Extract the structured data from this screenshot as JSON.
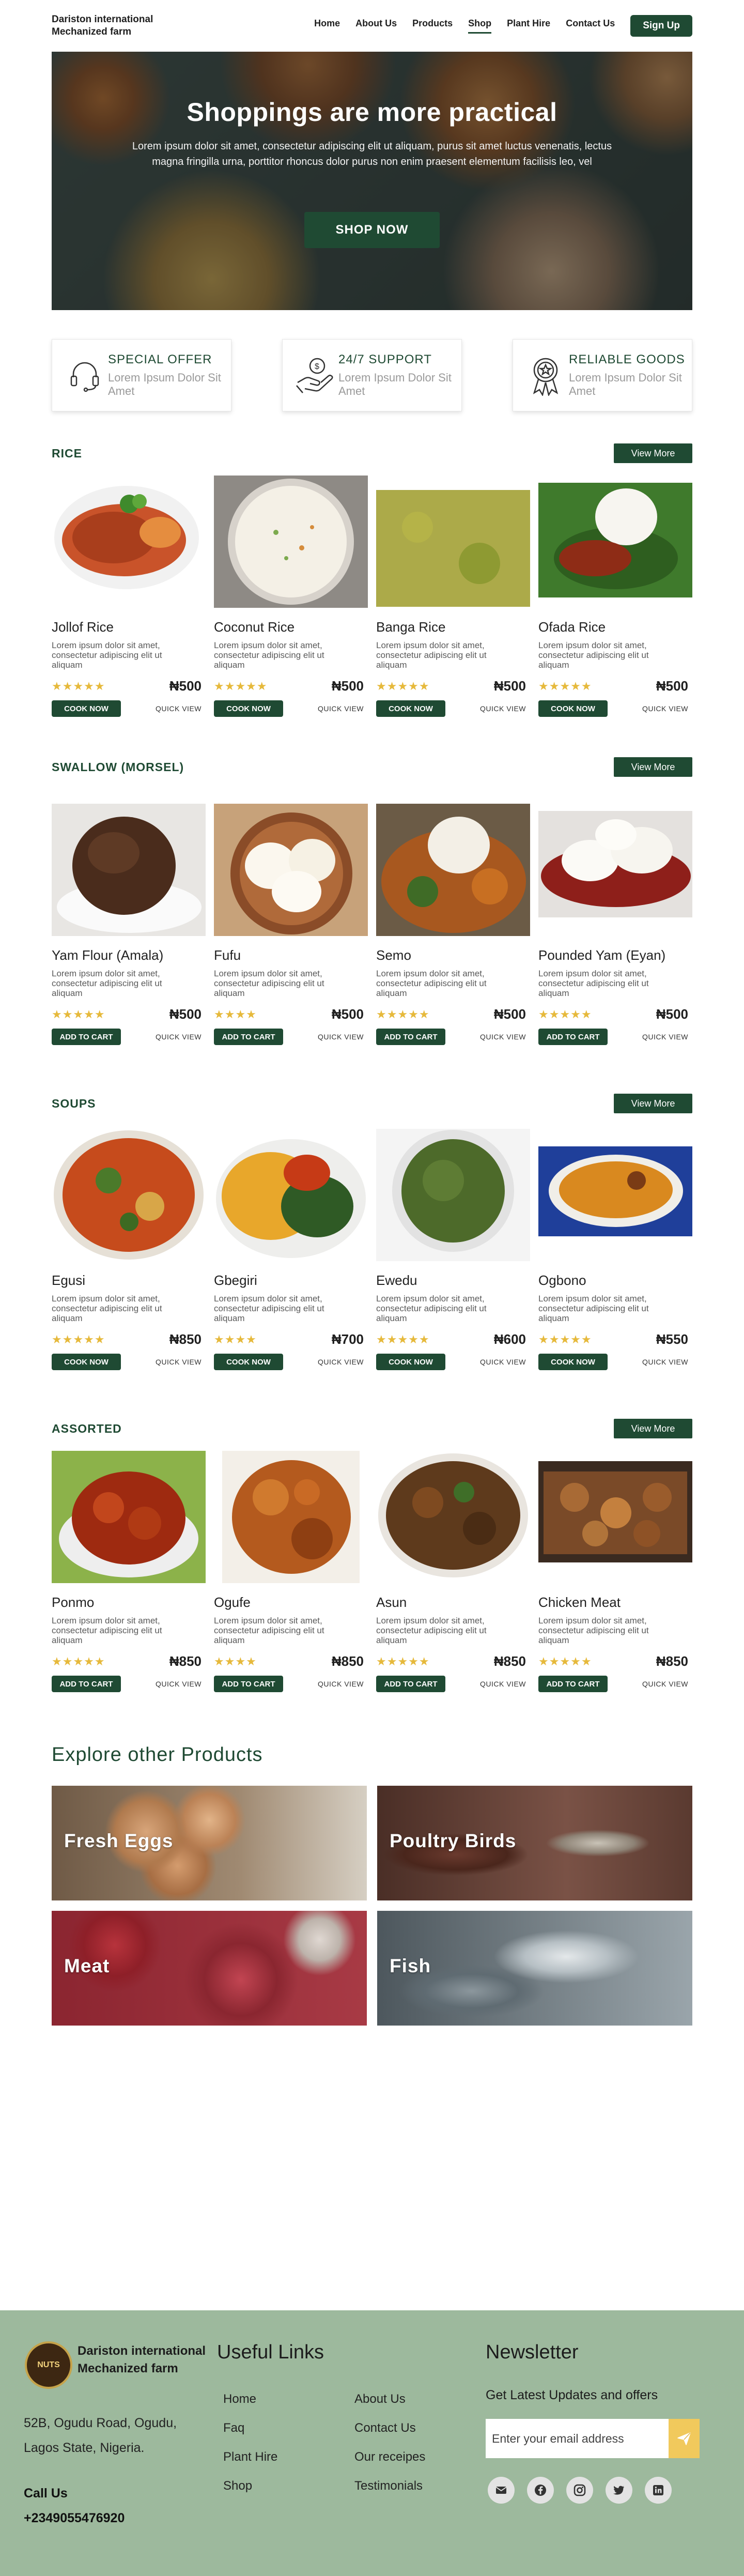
{
  "nav": {
    "brand": "Dariston international Mechanized farm",
    "links": [
      {
        "label": "Home",
        "active": false
      },
      {
        "label": "About Us",
        "active": false
      },
      {
        "label": "Products",
        "active": false
      },
      {
        "label": "Shop",
        "active": true
      },
      {
        "label": "Plant Hire",
        "active": false
      },
      {
        "label": "Contact Us",
        "active": false
      }
    ],
    "signup_label": "Sign Up"
  },
  "hero": {
    "title": "Shoppings are more practical",
    "text": "Lorem ipsum dolor sit amet, consectetur adipiscing elit ut aliquam, purus sit amet luctus venenatis, lectus magna fringilla urna, porttitor rhoncus dolor purus non enim praesent elementum facilisis leo, vel",
    "button": "SHOP NOW"
  },
  "features": [
    {
      "icon": "headset-icon",
      "title": "SPECIAL OFFER",
      "subtitle": "Lorem Ipsum Dolor Sit Amet"
    },
    {
      "icon": "hand-coin-icon",
      "title": "24/7 SUPPORT",
      "subtitle": "Lorem Ipsum Dolor Sit Amet"
    },
    {
      "icon": "award-badge-icon",
      "title": "RELIABLE GOODS",
      "subtitle": "Lorem Ipsum Dolor Sit Amet"
    }
  ],
  "sections": [
    {
      "title": "RICE",
      "view_more": "View More",
      "items": [
        {
          "name": "Jollof Rice",
          "desc": "Lorem ipsum dolor sit amet, consectetur adipiscing elit ut aliquam",
          "stars": "★★★★★",
          "price": "₦500",
          "button": "COOK NOW",
          "quick": "QUICK VIEW",
          "image": "jollof-rice-image"
        },
        {
          "name": "Coconut Rice",
          "desc": "Lorem ipsum dolor sit amet, consectetur adipiscing elit ut aliquam",
          "stars": "★★★★★",
          "price": "₦500",
          "button": "COOK NOW",
          "quick": "QUICK VIEW",
          "image": "coconut-rice-image"
        },
        {
          "name": "Banga Rice",
          "desc": "Lorem ipsum dolor sit amet, consectetur adipiscing elit ut aliquam",
          "stars": "★★★★★",
          "price": "₦500",
          "button": "COOK NOW",
          "quick": "QUICK VIEW",
          "image": "banga-rice-image"
        },
        {
          "name": "Ofada Rice",
          "desc": "Lorem ipsum dolor sit amet, consectetur adipiscing elit ut aliquam",
          "stars": "★★★★★",
          "price": "₦500",
          "button": "COOK NOW",
          "quick": "QUICK VIEW",
          "image": "ofada-rice-image"
        }
      ]
    },
    {
      "title": "SWALLOW (MORSEL)",
      "view_more": "View More",
      "items": [
        {
          "name": "Yam Flour (Amala)",
          "desc": "Lorem ipsum dolor sit amet, consectetur adipiscing elit ut aliquam",
          "stars": "★★★★★",
          "price": "₦500",
          "button": "ADD TO CART",
          "quick": "QUICK VIEW",
          "image": "amala-image"
        },
        {
          "name": "Fufu",
          "desc": "Lorem ipsum dolor sit amet, consectetur adipiscing elit ut aliquam",
          "stars": "★★★★",
          "price": "₦500",
          "button": "ADD TO CART",
          "quick": "QUICK VIEW",
          "image": "fufu-image"
        },
        {
          "name": "Semo",
          "desc": "Lorem ipsum dolor sit amet, consectetur adipiscing elit ut aliquam",
          "stars": "★★★★★",
          "price": "₦500",
          "button": "ADD TO CART",
          "quick": "QUICK VIEW",
          "image": "semo-image"
        },
        {
          "name": "Pounded Yam (Eyan)",
          "desc": "Lorem ipsum dolor sit amet, consectetur adipiscing elit ut aliquam",
          "stars": "★★★★★",
          "price": "₦500",
          "button": "ADD TO CART",
          "quick": "QUICK VIEW",
          "image": "pounded-yam-image"
        }
      ]
    },
    {
      "title": "SOUPS",
      "view_more": "View More",
      "items": [
        {
          "name": "Egusi",
          "desc": "Lorem ipsum dolor sit amet, consectetur adipiscing elit ut aliquam",
          "stars": "★★★★★",
          "price": "₦850",
          "button": "COOK NOW",
          "quick": "QUICK VIEW",
          "image": "egusi-image"
        },
        {
          "name": "Gbegiri",
          "desc": "Lorem ipsum dolor sit amet, consectetur adipiscing elit ut aliquam",
          "stars": "★★★★",
          "price": "₦700",
          "button": "COOK NOW",
          "quick": "QUICK VIEW",
          "image": "gbegiri-image"
        },
        {
          "name": "Ewedu",
          "desc": "Lorem ipsum dolor sit amet, consectetur adipiscing elit ut aliquam",
          "stars": "★★★★★",
          "price": "₦600",
          "button": "COOK NOW",
          "quick": "QUICK VIEW",
          "image": "ewedu-image"
        },
        {
          "name": "Ogbono",
          "desc": "Lorem ipsum dolor sit amet, consectetur adipiscing elit ut aliquam",
          "stars": "★★★★★",
          "price": "₦550",
          "button": "COOK NOW",
          "quick": "QUICK VIEW",
          "image": "ogbono-image"
        }
      ]
    },
    {
      "title": "ASSORTED",
      "view_more": "View More",
      "items": [
        {
          "name": "Ponmo",
          "desc": "Lorem ipsum dolor sit amet, consectetur adipiscing elit ut aliquam",
          "stars": "★★★★★",
          "price": "₦850",
          "button": "ADD TO CART",
          "quick": "QUICK VIEW",
          "image": "ponmo-image"
        },
        {
          "name": "Ogufe",
          "desc": "Lorem ipsum dolor sit amet, consectetur adipiscing elit ut aliquam",
          "stars": "★★★★",
          "price": "₦850",
          "button": "ADD TO CART",
          "quick": "QUICK VIEW",
          "image": "ogufe-image"
        },
        {
          "name": "Asun",
          "desc": "Lorem ipsum dolor sit amet, consectetur adipiscing elit ut aliquam",
          "stars": "★★★★★",
          "price": "₦850",
          "button": "ADD TO CART",
          "quick": "QUICK VIEW",
          "image": "asun-image"
        },
        {
          "name": "Chicken Meat",
          "desc": "Lorem ipsum dolor sit amet, consectetur adipiscing elit ut aliquam",
          "stars": "★★★★★",
          "price": "₦850",
          "button": "ADD TO CART",
          "quick": "QUICK VIEW",
          "image": "chicken-meat-image"
        }
      ]
    }
  ],
  "explore": {
    "title": "Explore other Products",
    "tiles": [
      {
        "label": "Fresh Eggs",
        "image": "fresh-eggs-image"
      },
      {
        "label": "Poultry Birds",
        "image": "poultry-birds-image"
      },
      {
        "label": "Meat",
        "image": "meat-image"
      },
      {
        "label": "Fish",
        "image": "fish-image"
      }
    ]
  },
  "footer": {
    "logo_text": "NUTS",
    "brand": "Dariston international Mechanized farm",
    "address": "52B, Ogudu Road, Ogudu, Lagos State, Nigeria.",
    "call_label": "Call Us",
    "phone": "+2349055476920",
    "links_title": "Useful Links",
    "links": [
      "Home",
      "About Us",
      "Faq",
      "Contact Us",
      "Plant Hire",
      "Our receipes",
      "Shop",
      "Testimonials"
    ],
    "newsletter_title": "Newsletter",
    "newsletter_sub": "Get Latest Updates and offers",
    "email_placeholder": "Enter your email address",
    "socials": [
      "email-icon",
      "facebook-icon",
      "instagram-icon",
      "twitter-icon",
      "linkedin-icon"
    ]
  },
  "colors": {
    "brand_green": "#1f4a33",
    "footer_bg": "#9db99d",
    "star_gold": "#e6b93b",
    "send_yellow": "#f1c95c"
  }
}
